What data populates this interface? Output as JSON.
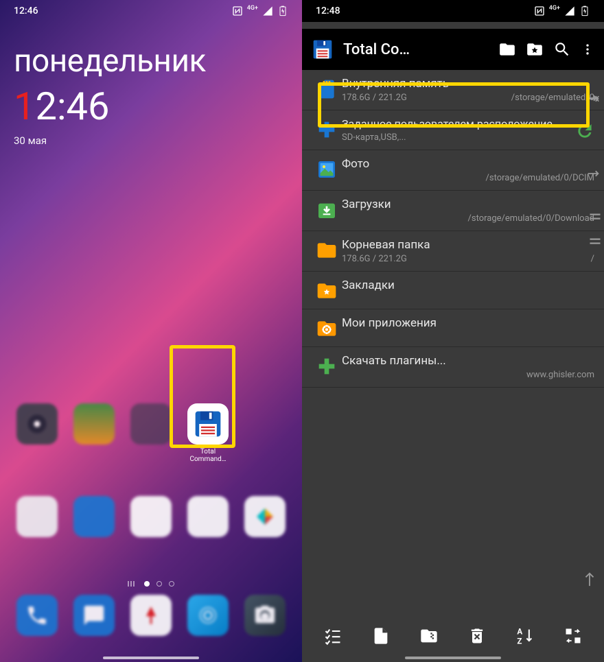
{
  "left_phone": {
    "status": {
      "time": "12:46",
      "nfc": "NFC",
      "net": "4G+"
    },
    "day_name": "понедельник",
    "clock_first": "1",
    "clock_rest": "2:46",
    "date": "30 мая",
    "highlighted_app": {
      "label": "Total Command…"
    }
  },
  "right_phone": {
    "status": {
      "time": "12:48",
      "nfc": "NFC",
      "net": "4G+"
    },
    "appbar": {
      "title": "Total Co…"
    },
    "list": [
      {
        "title": "Внутренняя память",
        "size": "178.6G / 221.2G",
        "path": "/storage/emulated/0",
        "icon": "sd-card",
        "highlighted": true
      },
      {
        "title": "Заданное пользователем расположение",
        "sub": "SD-карта,USB,...",
        "icon": "plus-blue",
        "refresh": true
      },
      {
        "title": "Фото",
        "path": "/storage/emulated/0/DCIM",
        "icon": "photo"
      },
      {
        "title": "Загрузки",
        "path": "/storage/emulated/0/Download",
        "icon": "download"
      },
      {
        "title": "Корневая папка",
        "size": "178.6G / 221.2G",
        "path": "/",
        "icon": "folder"
      },
      {
        "title": "Закладки",
        "icon": "bookmark"
      },
      {
        "title": "Мои приложения",
        "icon": "apps"
      },
      {
        "title": "Скачать плагины...",
        "path": "www.ghisler.com",
        "icon": "plus-green"
      }
    ]
  }
}
